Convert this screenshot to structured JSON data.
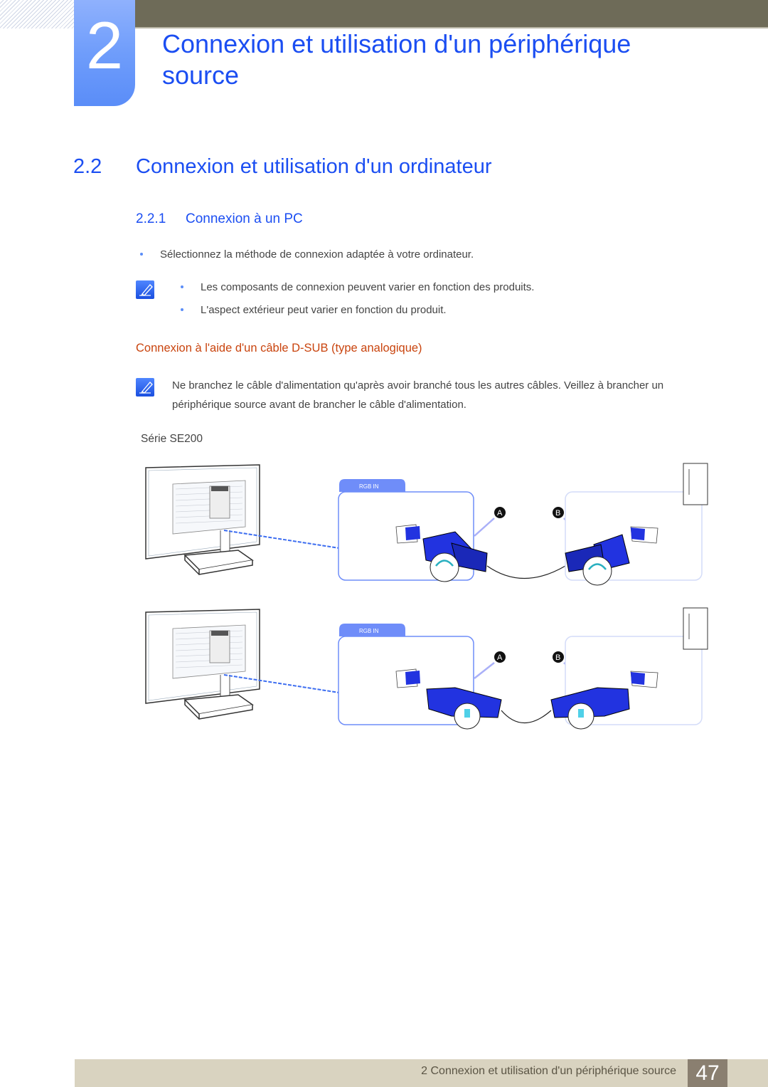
{
  "chapter": {
    "number": "2",
    "title_line1": "Connexion et utilisation d'un périphérique",
    "title_line2": "source"
  },
  "section": {
    "number": "2.2",
    "title": "Connexion et utilisation d'un ordinateur"
  },
  "subsection": {
    "number": "2.2.1",
    "title": "Connexion à un PC"
  },
  "intro_bullet": "Sélectionnez la méthode de connexion adaptée à votre ordinateur.",
  "note1": {
    "icon": "note-pencil-icon",
    "bullets": [
      "Les composants de connexion peuvent varier en fonction des produits.",
      "L'aspect extérieur peut varier en fonction du produit."
    ]
  },
  "dsub_heading": "Connexion à l'aide d'un câble D-SUB (type analogique)",
  "note2": {
    "icon": "note-pencil-icon",
    "text": "Ne branchez le câble d'alimentation qu'après avoir branché tous les autres câbles. Veillez à brancher un périphérique source avant de brancher le câble d'alimentation."
  },
  "series_label": "Série SE200",
  "diagrams": [
    {
      "port_label": "RGB IN",
      "marker_a": "A",
      "marker_b": "B",
      "connector_style": "screw"
    },
    {
      "port_label": "RGB IN",
      "marker_a": "A",
      "marker_b": "B",
      "connector_style": "thumb"
    }
  ],
  "colors": {
    "heading_blue": "#1b4ef2",
    "subheading_orange": "#c9440e",
    "connector_blue": "#2233e0",
    "footer_bg": "#d9d3c0",
    "page_num_bg": "#8a7f70",
    "topbar": "#6e6b58"
  },
  "footer": {
    "text": "2 Connexion et utilisation d'un périphérique source",
    "page": "47"
  }
}
